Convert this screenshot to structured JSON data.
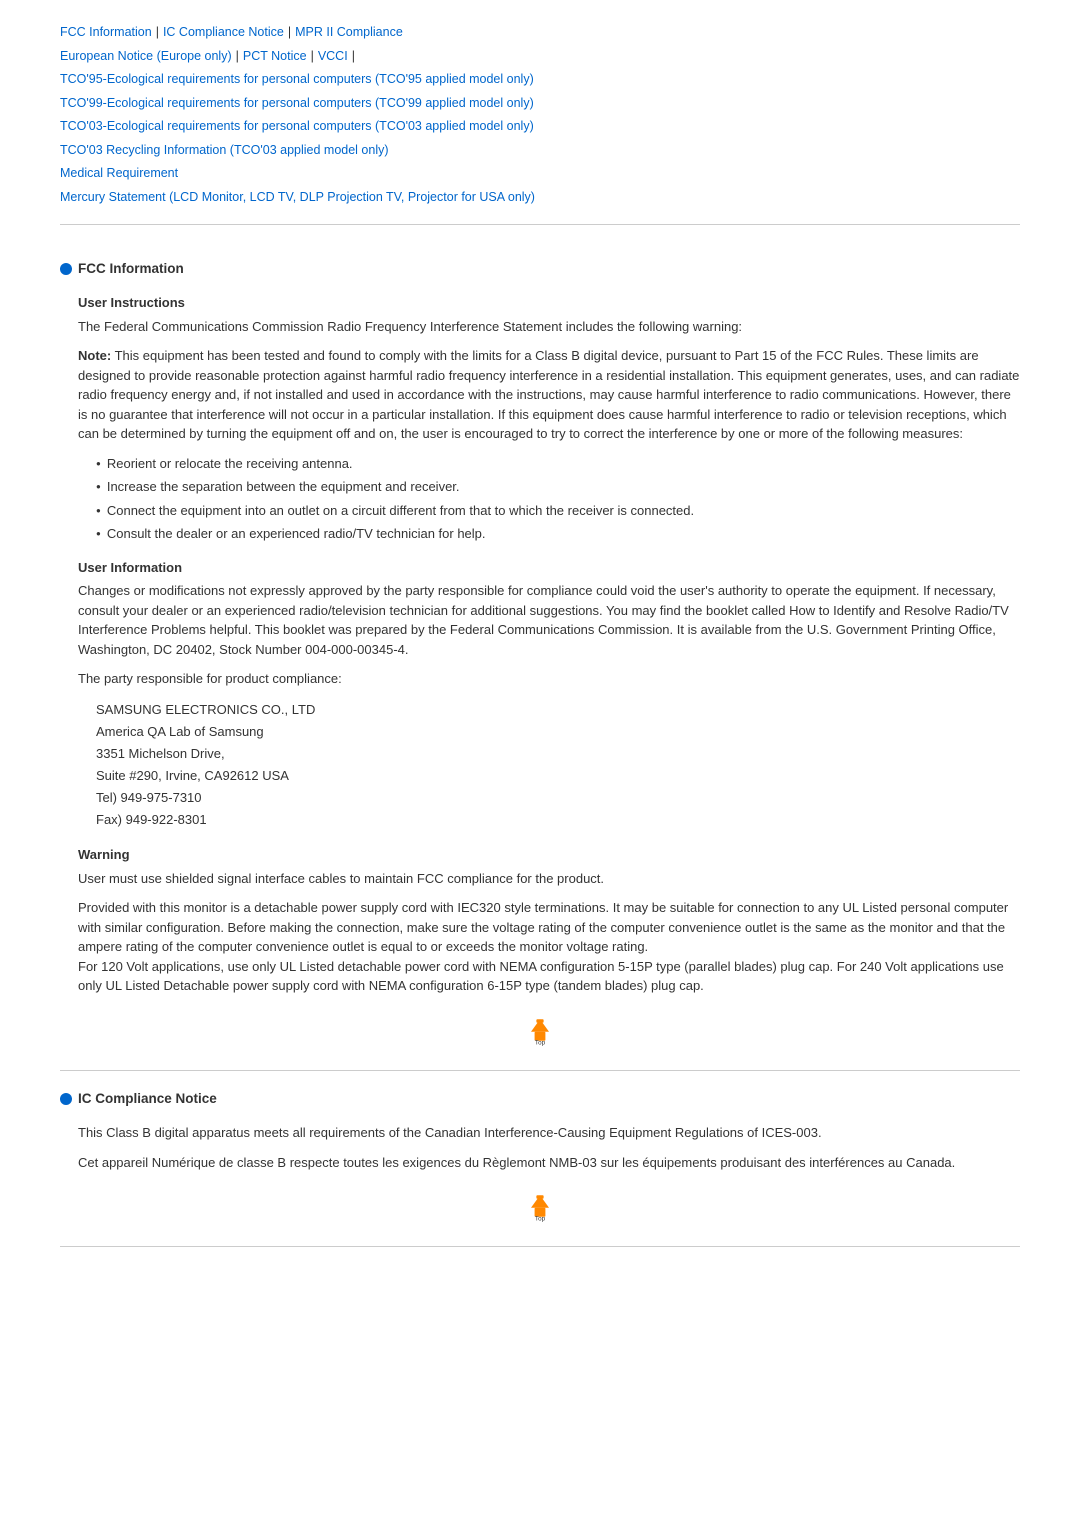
{
  "nav": {
    "links": [
      {
        "label": "FCC Information",
        "id": "fcc-info-link"
      },
      {
        "label": "IC Compliance Notice",
        "id": "ic-compliance-link"
      },
      {
        "label": "MPR II Compliance",
        "id": "mpr-link"
      },
      {
        "label": "European Notice (Europe only)",
        "id": "european-link"
      },
      {
        "label": "PCT Notice",
        "id": "pct-link"
      },
      {
        "label": "VCCI",
        "id": "vcci-link"
      },
      {
        "label": "TCO'95-Ecological requirements for personal computers (TCO'95 applied model only)",
        "id": "tco95-link"
      },
      {
        "label": "TCO'99-Ecological requirements for personal computers (TCO'99 applied model only)",
        "id": "tco99-link"
      },
      {
        "label": "TCO'03-Ecological requirements for personal computers (TCO'03 applied model only)",
        "id": "tco03-link"
      },
      {
        "label": "TCO'03 Recycling Information (TCO'03 applied model only)",
        "id": "tco03-recycling-link"
      },
      {
        "label": "Medical Requirement",
        "id": "medical-link"
      },
      {
        "label": "Mercury Statement (LCD Monitor, LCD TV, DLP Projection TV, Projector for USA only)",
        "id": "mercury-link"
      }
    ]
  },
  "fcc_section": {
    "title": "FCC Information",
    "user_instructions": {
      "heading": "User Instructions",
      "intro": "The Federal Communications Commission Radio Frequency Interference Statement includes the following warning:",
      "note_bold": "Note:",
      "note_text": " This equipment has been tested and found to comply with the limits for a Class B digital device, pursuant to Part 15 of the FCC Rules. These limits are designed to provide reasonable protection against harmful radio frequency interference in a residential installation. This equipment generates, uses, and can radiate radio frequency energy and, if not installed and used in accordance with the instructions, may cause harmful interference to radio communications. However, there is no guarantee that interference will not occur in a particular installation. If this equipment does cause harmful interference to radio or television receptions, which can be determined by turning the equipment off and on, the user is encouraged to try to correct the interference by one or more of the following measures:",
      "bullets": [
        "Reorient or relocate the receiving antenna.",
        "Increase the separation between the equipment and receiver.",
        "Connect the equipment into an outlet on a circuit different from that to which the receiver is connected.",
        "Consult the dealer or an experienced radio/TV technician for help."
      ]
    },
    "user_information": {
      "heading": "User Information",
      "para1": "Changes or modifications not expressly approved by the party responsible for compliance could void the user's authority to operate the equipment. If necessary, consult your dealer or an experienced radio/television technician for additional suggestions. You may find the booklet called How to Identify and Resolve Radio/TV Interference Problems helpful. This booklet was prepared by the Federal Communications Commission. It is available from the U.S. Government Printing Office, Washington, DC 20402, Stock Number 004-000-00345-4.",
      "para2": "The party responsible for product compliance:",
      "address": "SAMSUNG ELECTRONICS CO., LTD\nAmerica QA Lab of Samsung\n3351 Michelson Drive,\nSuite #290, Irvine, CA92612 USA\nTel) 949-975-7310\nFax) 949-922-8301"
    },
    "warning": {
      "heading": "Warning",
      "para1": "User must use shielded signal interface cables to maintain FCC compliance for the product.",
      "para2": "Provided with this monitor is a detachable power supply cord with IEC320 style terminations. It may be suitable for connection to any UL Listed personal computer with similar configuration. Before making the connection, make sure the voltage rating of the computer convenience outlet is the same as the monitor and that the ampere rating of the computer convenience outlet is equal to or exceeds the monitor voltage rating.\nFor 120 Volt applications, use only UL Listed detachable power cord with NEMA configuration 5-15P type (parallel blades) plug cap. For 240 Volt applications use only UL Listed Detachable power supply cord with NEMA configuration 6-15P type (tandem blades) plug cap."
    }
  },
  "ic_section": {
    "title": "IC Compliance Notice",
    "para1": "This Class B digital apparatus meets all requirements of the Canadian Interference-Causing Equipment Regulations of ICES-003.",
    "para2": "Cet appareil Numérique de classe B respecte toutes les exigences du Règlemont NMB-03 sur les équipements produisant des interférences au Canada."
  },
  "top_button_label": "Top"
}
